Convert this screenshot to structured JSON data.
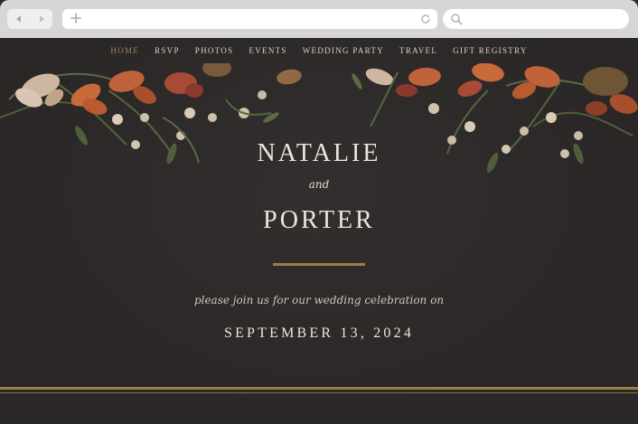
{
  "browser": {
    "back_icon": "back-arrow-icon",
    "forward_icon": "forward-arrow-icon",
    "new_tab_icon": "plus-icon",
    "reload_icon": "reload-icon",
    "search_icon": "search-icon"
  },
  "site": {
    "nav": {
      "items": [
        {
          "label": "HOME",
          "active": true
        },
        {
          "label": "RSVP",
          "active": false
        },
        {
          "label": "PHOTOS",
          "active": false
        },
        {
          "label": "EVENTS",
          "active": false
        },
        {
          "label": "WEDDING PARTY",
          "active": false
        },
        {
          "label": "TRAVEL",
          "active": false
        },
        {
          "label": "GIFT REGISTRY",
          "active": false
        }
      ]
    },
    "name_1": "NATALIE",
    "connector": "and",
    "name_2": "PORTER",
    "invite_text": "please join us for our wedding celebration on",
    "date": "SEPTEMBER 13, 2024"
  },
  "colors": {
    "background": "#2d2a29",
    "accent_gold": "#9b7d48",
    "nav_active": "#a08552",
    "text_light": "#ece6dd"
  }
}
